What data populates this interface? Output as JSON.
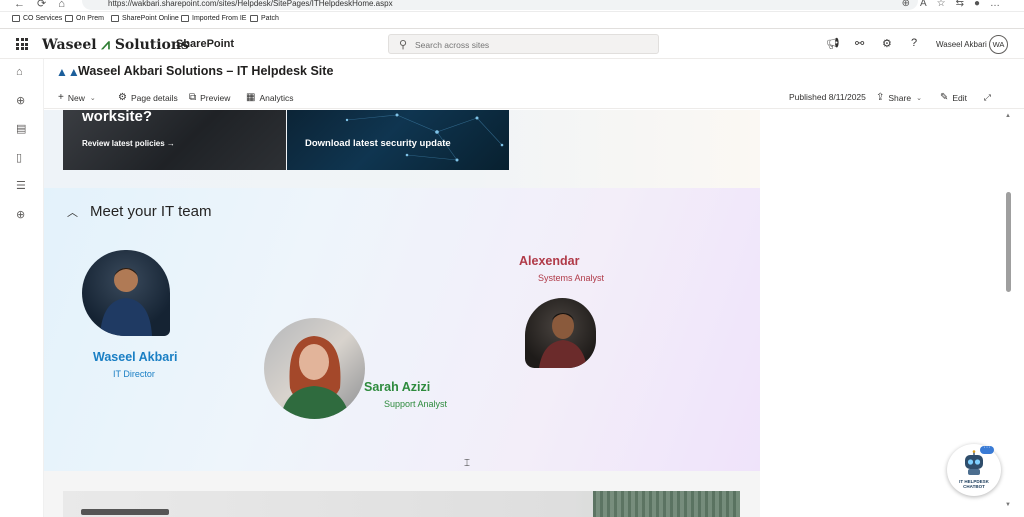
{
  "browser": {
    "url": "https://wakbari.sharepoint.com/sites/Helpdesk/SitePages/ITHelpdeskHome.aspx"
  },
  "bookmarks": [
    "CO Services",
    "On Prem",
    "SharePoint Online",
    "Imported From IE",
    "Patch"
  ],
  "suite": {
    "brand_left": "Waseel",
    "brand_right": "Solutions",
    "app": "SharePoint",
    "search_placeholder": "Search across sites",
    "user_name": "Waseel Akbari",
    "user_initials": "WA"
  },
  "site": {
    "title": "Waseel Akbari Solutions – IT Helpdesk Site"
  },
  "commands": {
    "new": "New",
    "page_details": "Page details",
    "preview": "Preview",
    "analytics": "Analytics",
    "published": "Published 8/11/2025",
    "share": "Share",
    "edit": "Edit"
  },
  "hero": {
    "tile1_heading": "worksite?",
    "tile1_link": "Review latest policies →",
    "tile2_text": "Download latest security update"
  },
  "team": {
    "title": "Meet your IT team",
    "members": [
      {
        "name": "Waseel Akbari",
        "role": "IT Director",
        "color": "#1a7fc4"
      },
      {
        "name": "Sarah Azizi",
        "role": "Support Analyst",
        "color": "#2e8b3d"
      },
      {
        "name": "Alexendar",
        "role": "Systems Analyst",
        "color": "#b03a48"
      }
    ]
  },
  "chatbot": {
    "label_line1": "IT HELPDESK",
    "label_line2": "CHATBOT"
  },
  "icons": {
    "waffle": "app-launcher-icon",
    "search": "search-icon",
    "megaphone": "megaphone-icon",
    "settings": "gear-icon",
    "help": "help-icon"
  }
}
